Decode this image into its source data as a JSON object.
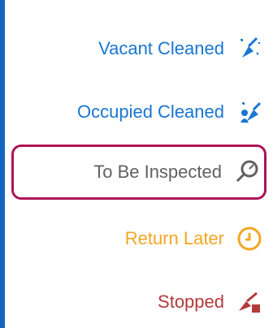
{
  "menu": {
    "items": [
      {
        "label": "Vacant Cleaned",
        "icon": "broom-sparkle-icon",
        "color": "#1976d2"
      },
      {
        "label": "Occupied Cleaned",
        "icon": "broom-people-icon",
        "color": "#1976d2"
      },
      {
        "label": "To Be Inspected",
        "icon": "magnifier-icon",
        "color": "#616161",
        "selected": true
      },
      {
        "label": "Return Later",
        "icon": "clock-icon",
        "color": "#f4a623"
      },
      {
        "label": "Stopped",
        "icon": "broom-stop-icon",
        "color": "#b23a3a"
      }
    ]
  },
  "colors": {
    "accent": "#1565c0",
    "selected_border": "#ad1457"
  }
}
